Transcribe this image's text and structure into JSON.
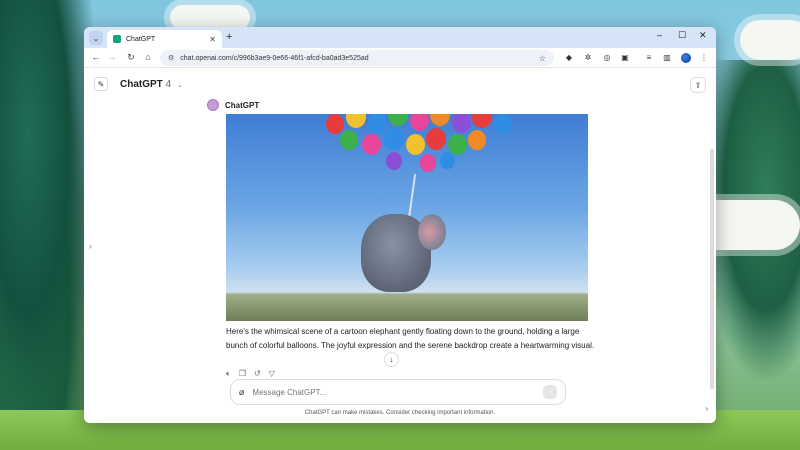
{
  "browser": {
    "tab_title": "ChatGPT",
    "url": "chat.openai.com/c/996b3ae9-0e66-46f1-afcd-ba0ad3e525ad",
    "window_controls": [
      "–",
      "☐",
      "✕"
    ]
  },
  "chat": {
    "model_name": "ChatGPT",
    "model_version": "4",
    "author": "ChatGPT",
    "image_alt": "",
    "response_text": "Here's the whimsical scene of a cartoon elephant gently floating down to the ground, holding a large bunch of colorful balloons. The joyful expression and the serene backdrop create a heartwarming visual.",
    "composer_placeholder": "Message ChatGPT...",
    "disclaimer": "ChatGPT can make mistakes. Consider checking important information."
  },
  "icons": {
    "tab_favicon": "chatgpt-logo",
    "edit": "pencil-square-icon",
    "share": "share-icon",
    "attach": "paperclip-icon",
    "send": "arrow-up-icon",
    "scroll": "arrow-down-icon"
  },
  "colors": {
    "tabbar": "#d6e4f7",
    "avatar": "#c79ad9",
    "accent": "#10a37f"
  }
}
